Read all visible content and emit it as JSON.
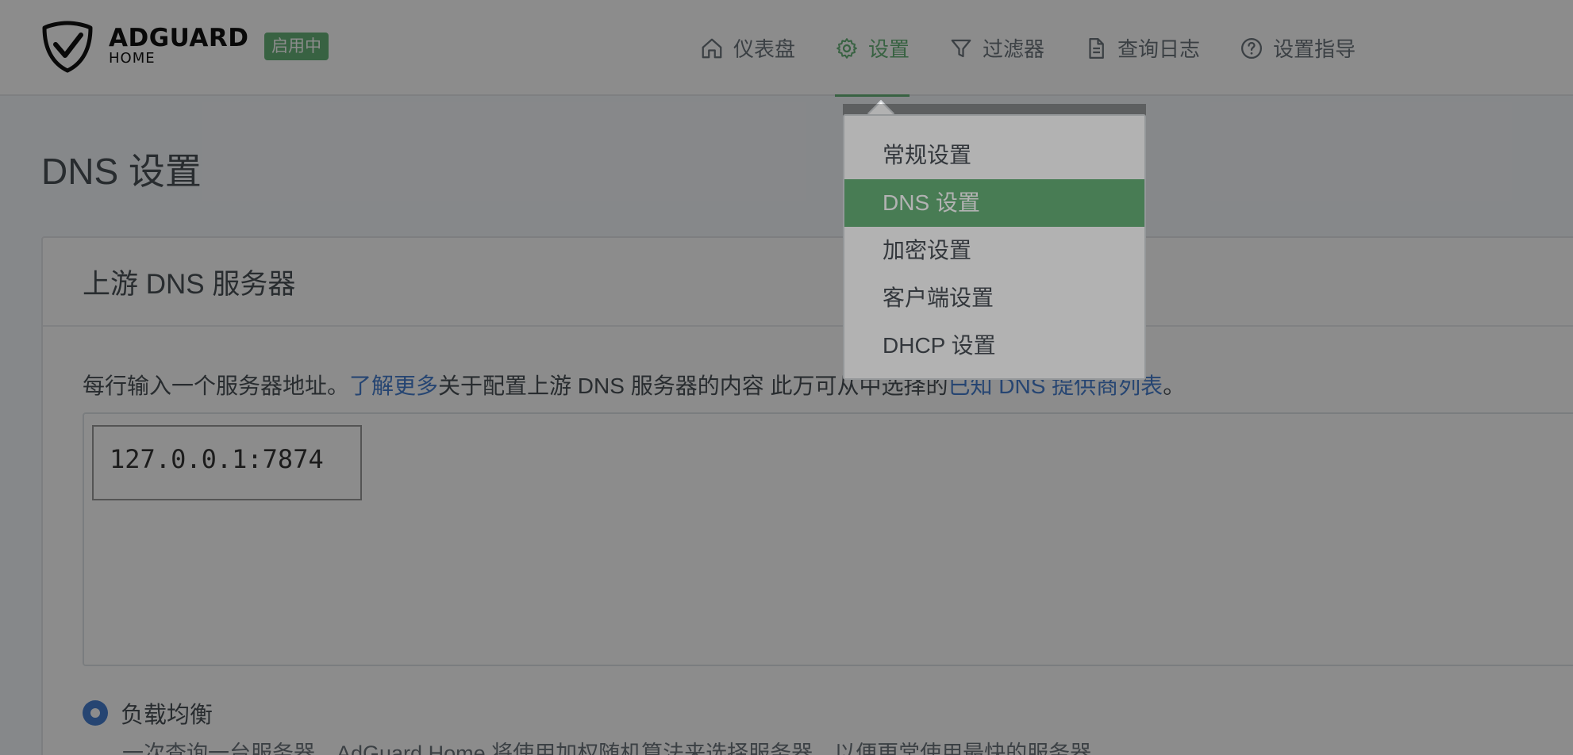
{
  "header": {
    "brand_main": "ADGUARD",
    "brand_sub": "HOME",
    "status_badge": "启用中",
    "nav": [
      {
        "label": "仪表盘",
        "icon": "home-icon"
      },
      {
        "label": "设置",
        "icon": "gear-icon",
        "active": true
      },
      {
        "label": "过滤器",
        "icon": "filter-icon"
      },
      {
        "label": "查询日志",
        "icon": "document-icon"
      },
      {
        "label": "设置指导",
        "icon": "help-circle-icon"
      }
    ]
  },
  "page": {
    "title": "DNS 设置"
  },
  "upstream": {
    "card_title": "上游 DNS 服务器",
    "desc_prefix": "每行输入一个服务器地址。",
    "desc_link1": "了解更多",
    "desc_middle": "关于配置上游 DNS 服务器的内容 此万可从中选择的",
    "desc_link2": "已知 DNS 提供商列表",
    "desc_suffix": "。",
    "value": "127.0.0.1:7874",
    "mode_label": "负载均衡",
    "mode_help": "一次查询一台服务器。AdGuard Home 将使用加权随机算法来选择服务器，以便更常使用最快的服务器。"
  },
  "dropdown": {
    "items": [
      "常规设置",
      "DNS 设置",
      "加密设置",
      "客户端设置",
      "DHCP 设置"
    ],
    "selected": "DNS 设置"
  },
  "colors": {
    "accent_green": "#67b279",
    "link_blue": "#467fcf",
    "overlay": "rgba(0,0,0,0.45)"
  }
}
